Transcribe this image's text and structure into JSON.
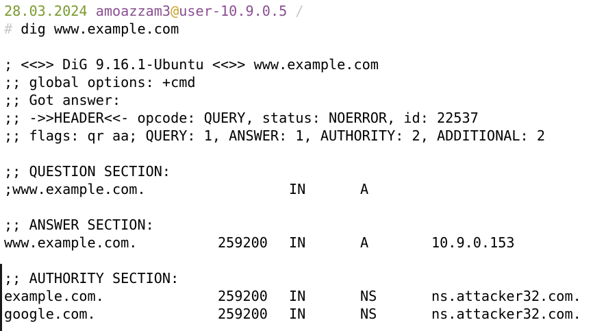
{
  "prompt": {
    "date": "28.03.2024",
    "username": "amoazzam3",
    "at": "@",
    "hostname": "user-10.9.0.5",
    "path": " /",
    "hash": "#",
    "command": " dig www.example.com"
  },
  "header_lines": [
    "; <<>> DiG 9.16.1-Ubuntu <<>> www.example.com",
    ";; global options: +cmd",
    ";; Got answer:",
    ";; ->>HEADER<<- opcode: QUERY, status: NOERROR, id: 22537",
    ";; flags: qr aa; QUERY: 1, ANSWER: 1, AUTHORITY: 2, ADDITIONAL: 2"
  ],
  "question_section": {
    "title": ";; QUESTION SECTION:",
    "rows": [
      {
        "name": ";www.example.com.",
        "ttl": "",
        "class": "IN",
        "type": "A",
        "data": ""
      }
    ]
  },
  "answer_section": {
    "title": ";; ANSWER SECTION:",
    "rows": [
      {
        "name": "www.example.com.",
        "ttl": "259200",
        "class": "IN",
        "type": "A",
        "data": "10.9.0.153"
      }
    ]
  },
  "authority_section": {
    "title": ";; AUTHORITY SECTION:",
    "rows": [
      {
        "name": "example.com.",
        "ttl": "259200",
        "class": "IN",
        "type": "NS",
        "data": "ns.attacker32.com."
      },
      {
        "name": "google.com.",
        "ttl": "259200",
        "class": "IN",
        "type": "NS",
        "data": "ns.attacker32.com."
      }
    ]
  },
  "colors": {
    "date": "#7a9a2e",
    "username": "#8a4f91",
    "at": "#c9a227",
    "hostname": "#8a4f91",
    "muted": "#c8c8c8",
    "text": "#000000",
    "background": "#ffffff"
  }
}
